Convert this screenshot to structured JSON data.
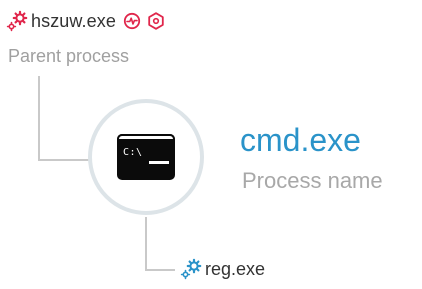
{
  "parent": {
    "name": "hszuw.exe",
    "caption": "Parent process",
    "icon": "gears-icon",
    "status_icons": [
      "activity-circle-icon",
      "hexagon-alert-icon"
    ],
    "accent_color": "#e0264b"
  },
  "process": {
    "name": "cmd.exe",
    "caption": "Process name",
    "icon": "console-icon",
    "console_prompt": "C:\\",
    "name_color": "#2a93c9"
  },
  "child": {
    "name": "reg.exe",
    "icon": "gears-icon",
    "icon_color": "#2a93c9"
  }
}
